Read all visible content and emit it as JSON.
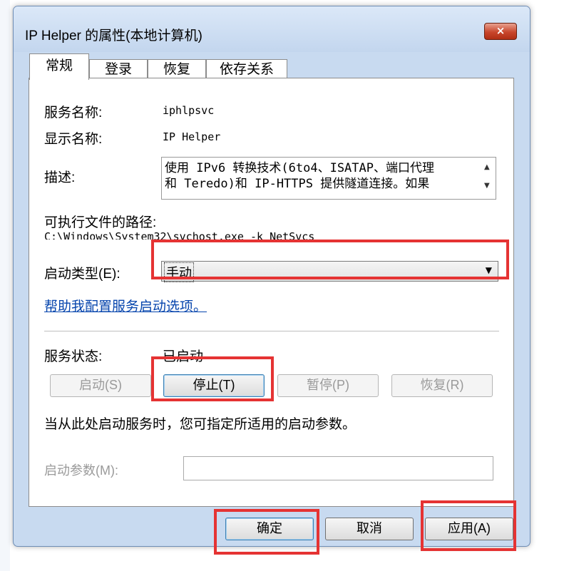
{
  "window": {
    "title": "IP Helper 的属性(本地计算机)",
    "close_icon": "×"
  },
  "tabs": [
    {
      "label": "常规",
      "active": true
    },
    {
      "label": "登录",
      "active": false
    },
    {
      "label": "恢复",
      "active": false
    },
    {
      "label": "依存关系",
      "active": false
    }
  ],
  "general": {
    "service_name_label": "服务名称:",
    "service_name_value": "iphlpsvc",
    "display_name_label": "显示名称:",
    "display_name_value": "IP Helper",
    "description_label": "描述:",
    "description_line1": "使用 IPv6 转换技术(6to4、ISATAP、端口代理",
    "description_line2": "和 Teredo)和 IP-HTTPS 提供隧道连接。如果",
    "exe_path_label": "可执行文件的路径:",
    "exe_path_value": "C:\\Windows\\System32\\svchost.exe -k NetSvcs",
    "startup_type_label": "启动类型(E):",
    "startup_type_value": "手动",
    "help_link": "帮助我配置服务启动选项。",
    "status_label": "服务状态:",
    "status_value": "已启动",
    "start_button": "启动(S)",
    "stop_button": "停止(T)",
    "pause_button": "暂停(P)",
    "resume_button": "恢复(R)",
    "hint_text": "当从此处启动服务时，您可指定所适用的启动参数。",
    "start_params_label": "启动参数(M):",
    "start_params_value": ""
  },
  "footer": {
    "ok_button": "确定",
    "cancel_button": "取消",
    "apply_button": "应用(A)"
  },
  "colors": {
    "highlight": "#e53333",
    "link": "#0645ad"
  }
}
